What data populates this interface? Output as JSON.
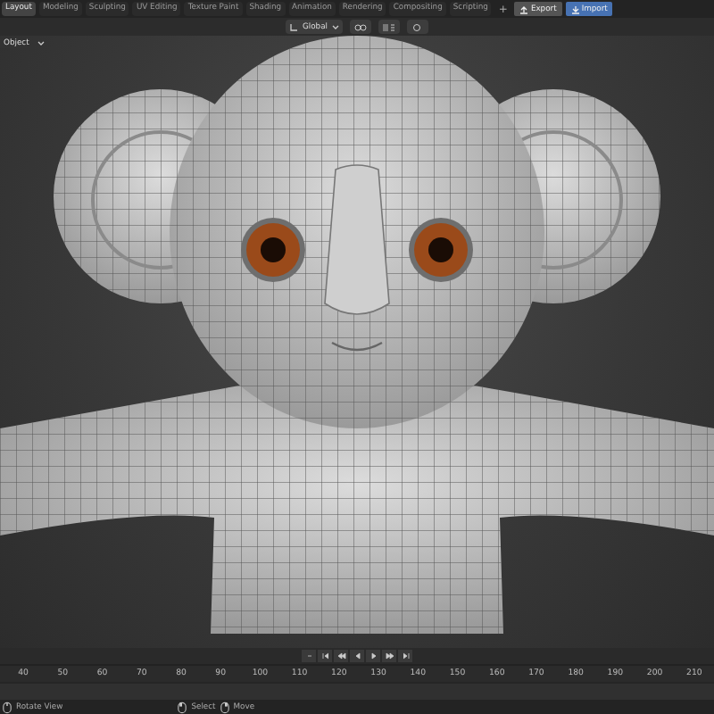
{
  "workspace_tabs": [
    {
      "label": "Layout",
      "selected": true
    },
    {
      "label": "Modeling",
      "selected": false
    },
    {
      "label": "Sculpting",
      "selected": false
    },
    {
      "label": "UV Editing",
      "selected": false
    },
    {
      "label": "Texture Paint",
      "selected": false
    },
    {
      "label": "Shading",
      "selected": false
    },
    {
      "label": "Animation",
      "selected": false
    },
    {
      "label": "Rendering",
      "selected": false
    },
    {
      "label": "Compositing",
      "selected": false
    },
    {
      "label": "Scripting",
      "selected": false
    }
  ],
  "add_tab": "+",
  "file_buttons": [
    {
      "label": "Export",
      "kind": "export"
    },
    {
      "label": "Import",
      "kind": "import"
    }
  ],
  "viewport_header": {
    "orientation": "Global"
  },
  "viewport": {
    "mode": "Object"
  },
  "timeline": {
    "frames": [
      "40",
      "50",
      "60",
      "70",
      "80",
      "90",
      "100",
      "110",
      "120",
      "130",
      "140",
      "150",
      "160",
      "170",
      "180",
      "190",
      "200",
      "210"
    ]
  },
  "status_bar": [
    {
      "label": "Rotate View",
      "kind": "mouse-middle"
    },
    {
      "label": "Select",
      "kind": "mouse-left"
    },
    {
      "label": "Move",
      "kind": "mouse-right"
    }
  ]
}
